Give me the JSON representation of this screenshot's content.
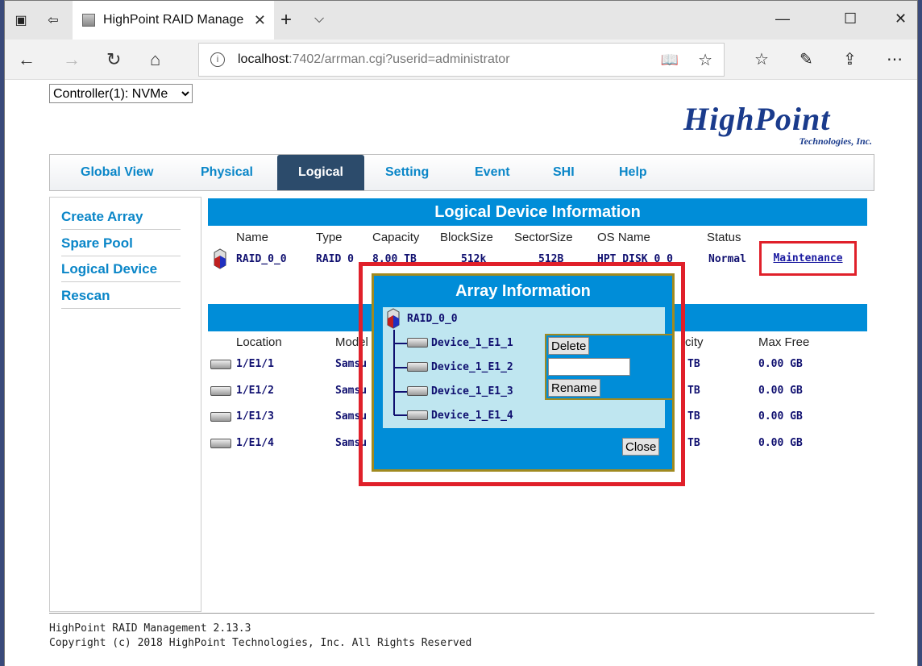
{
  "browser": {
    "tab_title": "HighPoint RAID Manage",
    "url_host": "localhost",
    "url_path": ":7402/arrman.cgi?userid=administrator"
  },
  "controller_select": "Controller(1): NVMe",
  "logo": {
    "big": "HighPoint",
    "small": "Technologies, Inc."
  },
  "menu": [
    "Global View",
    "Physical",
    "Logical",
    "Setting",
    "Event",
    "SHI",
    "Help"
  ],
  "sidebar": [
    "Create Array",
    "Spare Pool",
    "Logical Device",
    "Rescan"
  ],
  "logical_section": {
    "title": "Logical Device Information",
    "headers": [
      "Name",
      "Type",
      "Capacity",
      "BlockSize",
      "SectorSize",
      "OS Name",
      "Status"
    ],
    "row": {
      "name": "RAID_0_0",
      "type": "RAID 0",
      "capacity": "8.00 TB",
      "blocksize": "512k",
      "sectorsize": "512B",
      "os_name": "HPT DISK 0_0",
      "status": "Normal",
      "action": "Maintenance"
    }
  },
  "device_section": {
    "headers": [
      "Location",
      "Model",
      "city",
      "Max Free"
    ],
    "rows": [
      {
        "location": "1/E1/1",
        "model": "Samsu",
        "cap": "TB",
        "max_free": "0.00 GB"
      },
      {
        "location": "1/E1/2",
        "model": "Samsu",
        "cap": "TB",
        "max_free": "0.00 GB"
      },
      {
        "location": "1/E1/3",
        "model": "Samsu",
        "cap": "TB",
        "max_free": "0.00 GB"
      },
      {
        "location": "1/E1/4",
        "model": "Samsu",
        "cap": "TB",
        "max_free": "0.00 GB"
      }
    ]
  },
  "dialog": {
    "title": "Array Information",
    "root": "RAID_0_0",
    "devices": [
      "Device_1_E1_1",
      "Device_1_E1_2",
      "Device_1_E1_3",
      "Device_1_E1_4"
    ],
    "delete_label": "Delete",
    "rename_label": "Rename",
    "close_label": "Close"
  },
  "footer": {
    "line1": "HighPoint RAID Management 2.13.3",
    "line2": "Copyright (c) 2018 HighPoint Technologies, Inc. All Rights Reserved"
  }
}
